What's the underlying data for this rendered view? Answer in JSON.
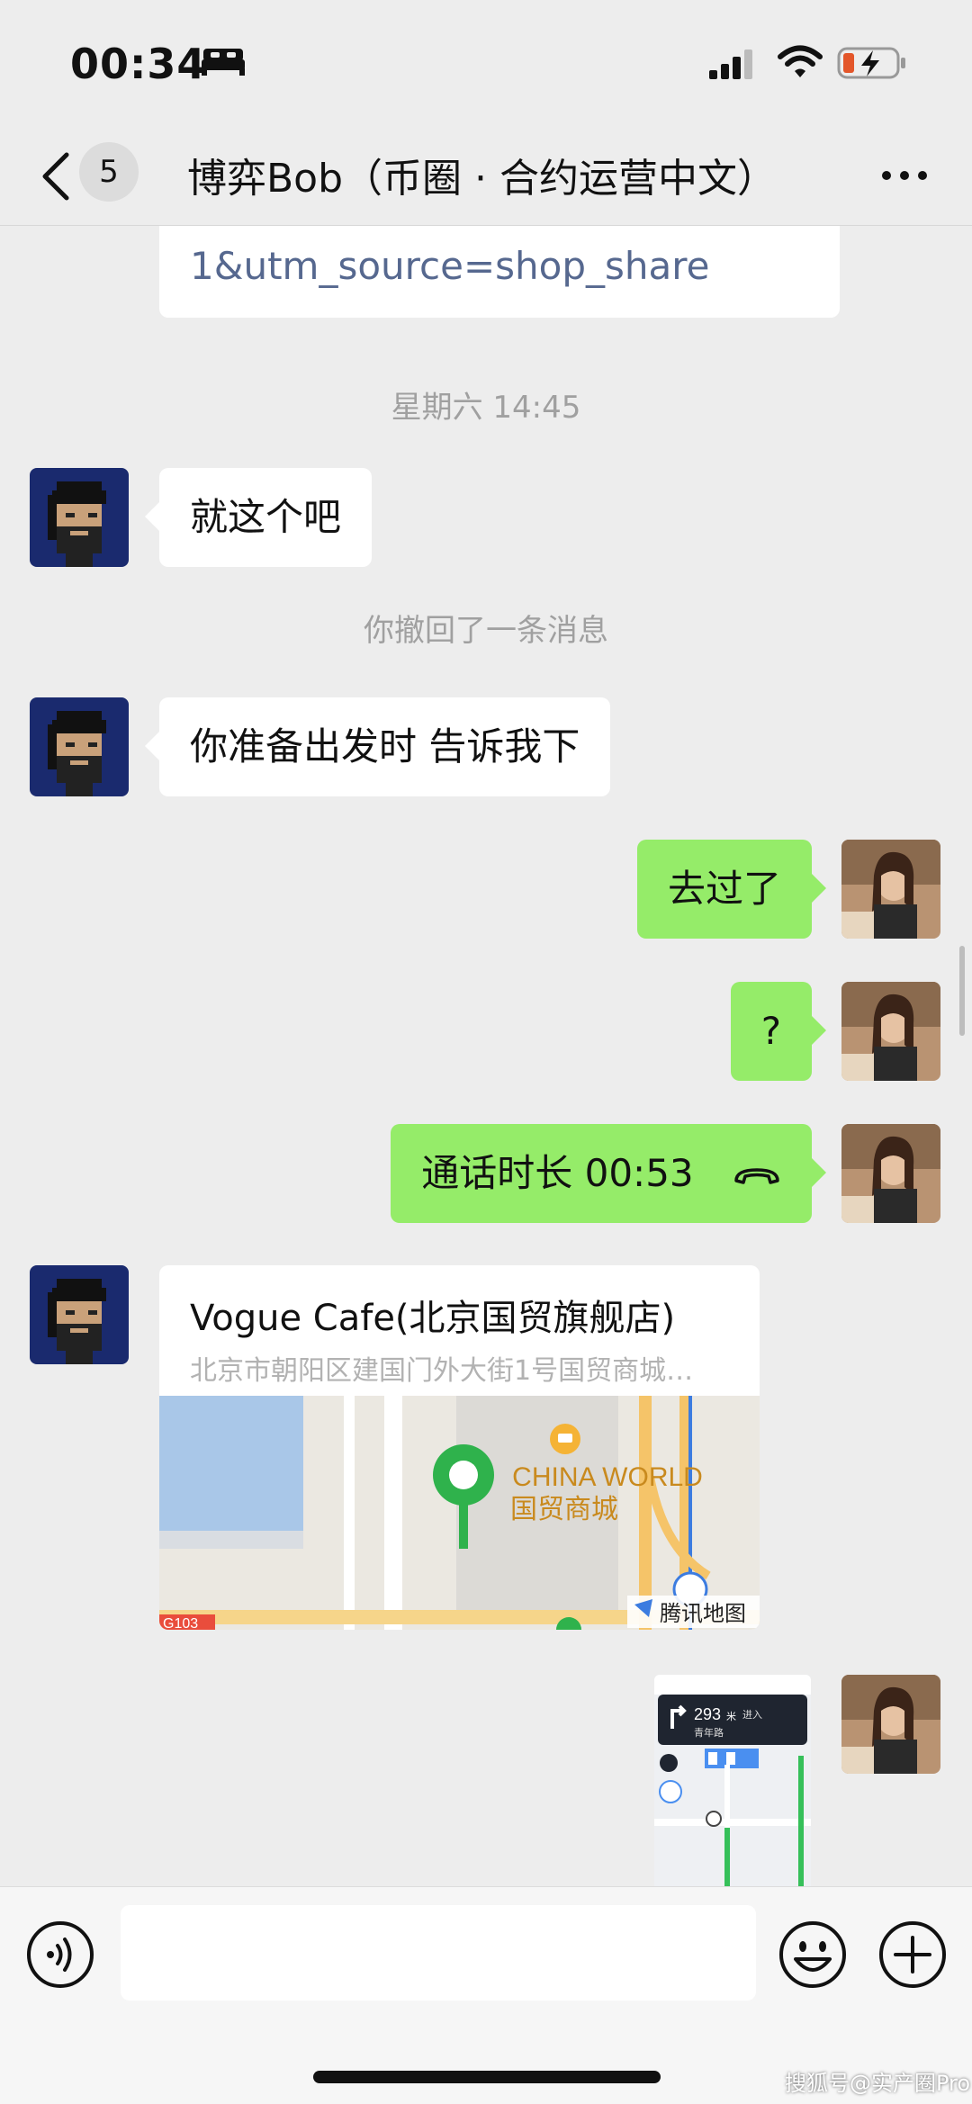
{
  "status_bar": {
    "time": "00:34",
    "icons": [
      "sleep-icon",
      "signal-icon",
      "wifi-icon",
      "battery-charging-icon"
    ]
  },
  "nav": {
    "unread_count": "5",
    "title": "博弈Bob（币圈 · 合约运营中文）",
    "icons": [
      "back-icon",
      "more-icon"
    ]
  },
  "messages": {
    "link_preview_tail": "1&utm_source=shop_share",
    "timestamp": "星期六 14:45",
    "msg1": "就这个吧",
    "recalled_notice": "你撤回了一条消息",
    "msg2": "你准备出发时 告诉我下",
    "msg3": "去过了",
    "msg4": "?",
    "call_label": "通话时长 00:53",
    "location": {
      "name": "Vogue Cafe(北京国贸旗舰店)",
      "address": "北京市朝阳区建国门外大街1号国贸商城…",
      "map_label_en": "CHINA WORLD",
      "map_label_cn": "国贸商城",
      "map_brand": "腾讯地图",
      "road_tag": "G103"
    },
    "nav_thumb": {
      "distance": "293",
      "unit": "米",
      "action": "进入",
      "road": "青年路"
    }
  },
  "input_bar": {
    "icons": [
      "voice-icon",
      "emoji-icon",
      "plus-icon"
    ]
  },
  "watermark": "搜狐号@实产圈Pro",
  "colors": {
    "background": "#ededed",
    "outgoing_bubble": "#95ec69",
    "incoming_bubble": "#ffffff",
    "link_text": "#56688f"
  }
}
